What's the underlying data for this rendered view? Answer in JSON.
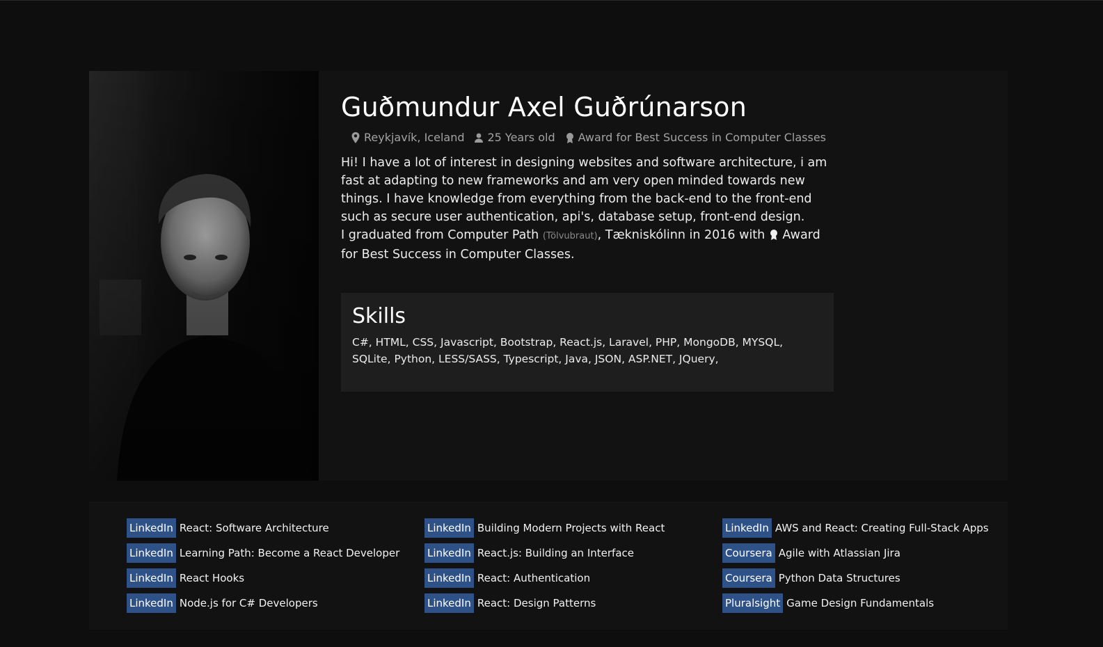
{
  "profile": {
    "name": "Guðmundur Axel Guðrúnarson",
    "location": "Reykjavík, Iceland",
    "age": "25 Years old",
    "award": "Award for Best Success in Computer Classes",
    "bio_1": "Hi! I have a lot of interest in designing websites and software architecture, i am fast at adapting to new frameworks and am very open minded towards new things. I have knowledge from everything from the back-end to the front-end such as secure user authentication, api's, database setup, front-end design.",
    "bio_2_pre": "I graduated from Computer Path",
    "bio_2_small": "(Tölvubraut)",
    "bio_2_mid": ", Tækniskólinn in 2016 with",
    "bio_2_post": "Award for Best Success in Computer Classes.",
    "icons": [
      "map-pin-icon",
      "person-icon",
      "award-icon"
    ]
  },
  "skills": {
    "title": "Skills",
    "list": "C#, HTML, CSS, Javascript, Bootstrap, React.js, Laravel, PHP, MongoDB, MYSQL, SQLite, Python, LESS/SASS, Typescript, Java, JSON, ASP.NET, JQuery,"
  },
  "courses": [
    [
      {
        "provider": "LinkedIn",
        "title": "React: Software Architecture"
      },
      {
        "provider": "LinkedIn",
        "title": "Learning Path: Become a React Developer"
      },
      {
        "provider": "LinkedIn",
        "title": "React Hooks"
      },
      {
        "provider": "LinkedIn",
        "title": "Node.js for C# Developers"
      }
    ],
    [
      {
        "provider": "LinkedIn",
        "title": "Building Modern Projects with React"
      },
      {
        "provider": "LinkedIn",
        "title": "React.js: Building an Interface"
      },
      {
        "provider": "LinkedIn",
        "title": "React: Authentication"
      },
      {
        "provider": "LinkedIn",
        "title": "React: Design Patterns"
      }
    ],
    [
      {
        "provider": "LinkedIn",
        "title": "AWS and React: Creating Full-Stack Apps"
      },
      {
        "provider": "Coursera",
        "title": "Agile with Atlassian Jira"
      },
      {
        "provider": "Coursera",
        "title": "Python Data Structures"
      },
      {
        "provider": "Pluralsight",
        "title": "Game Design Fundamentals"
      }
    ]
  ],
  "colors": {
    "background": "#0e0e0e",
    "card": "#121212",
    "skills_box": "#1e1e1e",
    "tag": "#2e5288"
  }
}
